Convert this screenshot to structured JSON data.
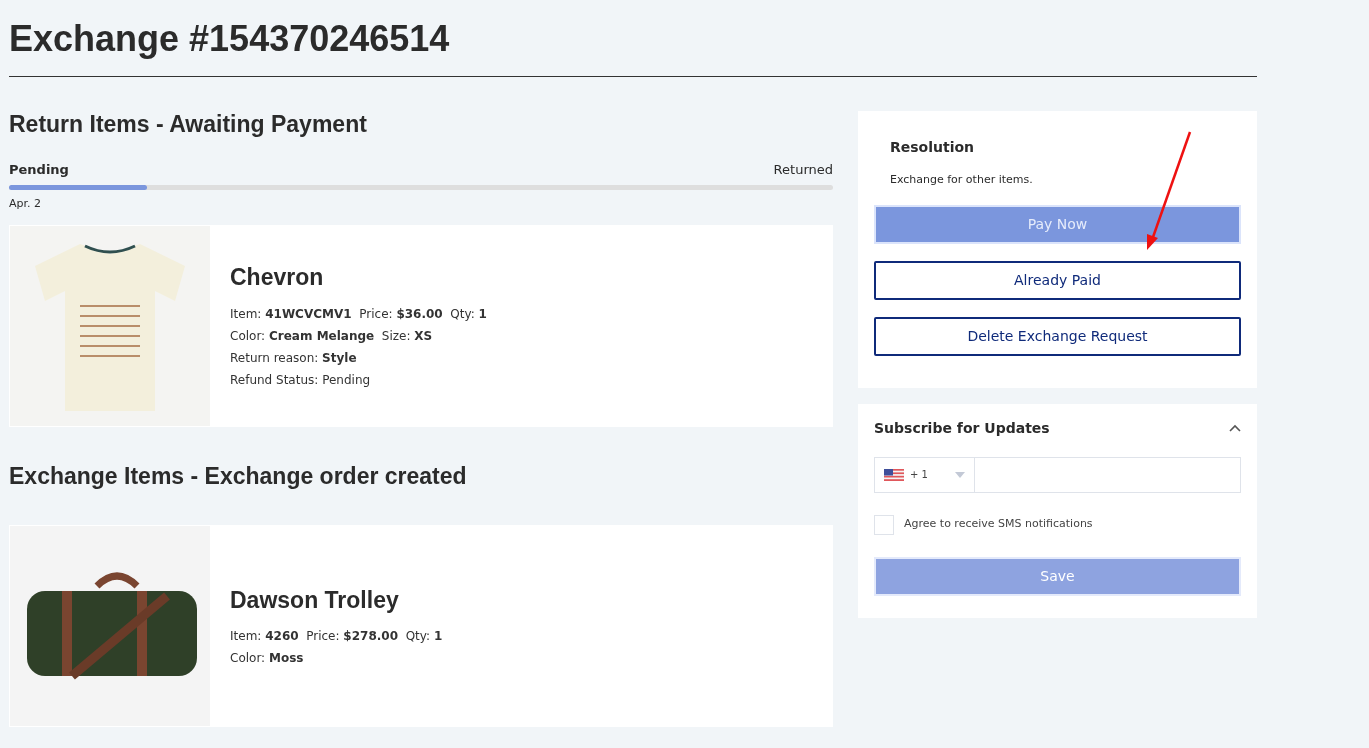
{
  "title": "Exchange #154370246514",
  "return_section": {
    "heading": "Return Items - Awaiting Payment",
    "progress": {
      "start_label": "Pending",
      "end_label": "Returned",
      "level": 0.167,
      "date": "Apr. 2"
    },
    "items": [
      {
        "kind": "shirt",
        "name": "Chevron",
        "lines": [
          "Item: **41WCVCMV1**  Price: **$36.00**  Qty: **1**",
          "Color: **Cream Melange**  Size: **XS**",
          "Return reason: **Style**",
          "Refund Status: Pending"
        ]
      }
    ]
  },
  "exchange_section": {
    "heading": "Exchange Items - Exchange order created",
    "items": [
      {
        "kind": "bag",
        "name": "Dawson Trolley",
        "lines": [
          "Item: **4260**  Price: **$278.00**  Qty: **1**",
          "Color: **Moss**"
        ]
      }
    ]
  },
  "resolution": {
    "title": "Resolution",
    "text": "Exchange for other items.",
    "buttons": [
      {
        "label": "Pay Now",
        "kind": "primary"
      },
      {
        "label": "Already Paid",
        "kind": "outline"
      },
      {
        "label": "Delete Exchange Request",
        "kind": "outline"
      }
    ]
  },
  "subscribe": {
    "title": "Subscribe for Updates",
    "expanded": true,
    "country_code": "+ 1",
    "checkbox": {
      "label": "Agree to receive SMS notifications",
      "checked": false
    },
    "save": {
      "label": "Save",
      "disabled": true
    }
  }
}
